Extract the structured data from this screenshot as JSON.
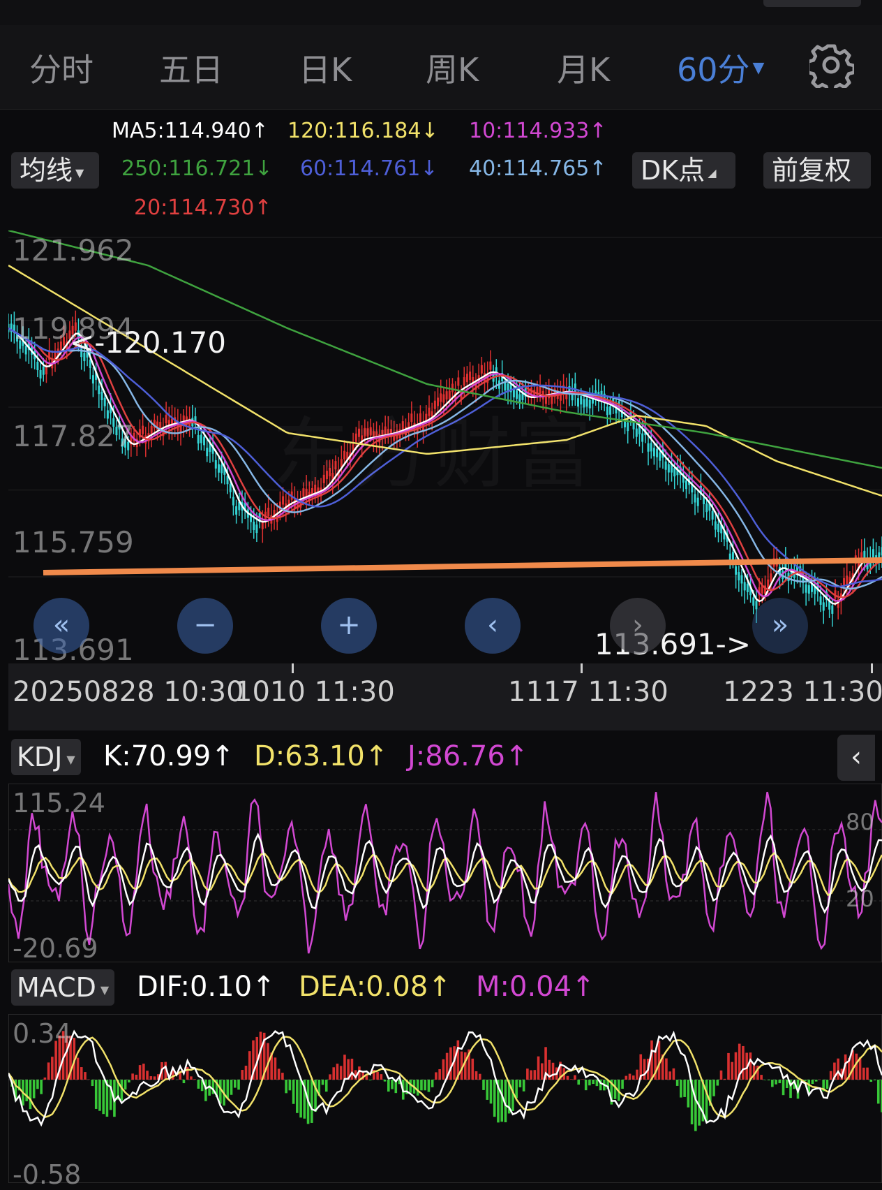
{
  "tabs": [
    {
      "label": "分时",
      "active": false
    },
    {
      "label": "五日",
      "active": false
    },
    {
      "label": "日K",
      "active": false
    },
    {
      "label": "周K",
      "active": false
    },
    {
      "label": "月K",
      "active": false
    },
    {
      "label": "60分",
      "active": true
    }
  ],
  "tab_dropdown_caret": "▼",
  "settings_icon": "gear-icon",
  "ma_selector": {
    "label": "均线",
    "caret": "▼"
  },
  "dk_button": {
    "label": "DK点",
    "caret": "◢"
  },
  "adjust_button": {
    "label": "前复权"
  },
  "moving_averages": [
    {
      "text": "MA5:114.940↑",
      "color": "#ffffff"
    },
    {
      "text": "120:116.184↓",
      "color": "#f2e26a"
    },
    {
      "text": "10:114.933↑",
      "color": "#d248d2"
    },
    {
      "text": "250:116.721↓",
      "color": "#3fa33f"
    },
    {
      "text": "60:114.761↓",
      "color": "#4e5fd8"
    },
    {
      "text": "40:114.765↑",
      "color": "#86b7e6"
    },
    {
      "text": "20:114.730↑",
      "color": "#e04040"
    }
  ],
  "price_axis": [
    "121.962",
    "119.894",
    "117.827",
    "115.759",
    "113.691"
  ],
  "annotations": {
    "high": "<-120.170",
    "low": "113.691->"
  },
  "watermark": "东方财富",
  "chart_controls": [
    {
      "name": "scroll-left-fast",
      "glyph": "«"
    },
    {
      "name": "zoom-out",
      "glyph": "−"
    },
    {
      "name": "zoom-in",
      "glyph": "+"
    },
    {
      "name": "scroll-left",
      "glyph": "‹"
    },
    {
      "name": "scroll-right",
      "glyph": "›"
    },
    {
      "name": "scroll-end",
      "glyph": "»"
    }
  ],
  "time_axis": [
    "20250828 10:30",
    "1010 11:30",
    "1117 11:30",
    "1223 11:30"
  ],
  "kdj": {
    "selector": "KDJ",
    "caret": "▼",
    "k": "K:70.99↑",
    "d": "D:63.10↑",
    "j": "J:86.76↑",
    "axis_top": "115.24",
    "axis_bottom": "-20.69",
    "ref_high": "80",
    "ref_low": "20",
    "colors": {
      "k": "#ffffff",
      "d": "#f2e26a",
      "j": "#d248d2"
    }
  },
  "collapse_icon": "‹",
  "macd": {
    "selector": "MACD",
    "caret": "▼",
    "dif": "DIF:0.10↑",
    "dea": "DEA:0.08↑",
    "m": "M:0.04↑",
    "axis_top": "0.34",
    "axis_bottom": "-0.58",
    "colors": {
      "dif": "#ffffff",
      "dea": "#f2e26a",
      "m": "#e040e0",
      "pos": "#d83030",
      "neg": "#38c838"
    }
  },
  "support_line_color": "#f08a4b",
  "up_color": "#e03030",
  "down_color": "#34d4d4"
}
